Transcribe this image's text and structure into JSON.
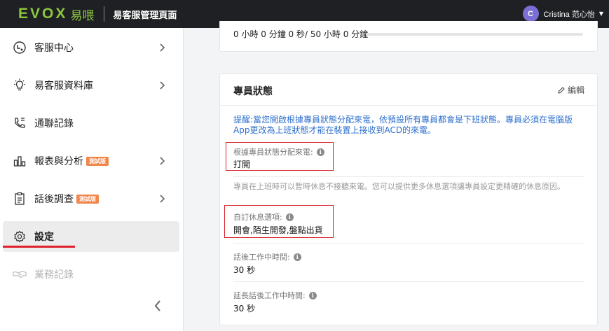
{
  "header": {
    "logo_mark": "EVOX",
    "logo_sub": "易喂",
    "title": "易客服管理頁面",
    "user": {
      "initial": "C",
      "name": "Cristina 范心怡"
    }
  },
  "sidebar": {
    "items": [
      {
        "label": "客服中心",
        "icon": "headset-icon"
      },
      {
        "label": "易客服資料庫",
        "icon": "lightbulb-icon"
      },
      {
        "label": "通聯記錄",
        "icon": "phone-icon"
      },
      {
        "label": "報表與分析",
        "icon": "bar-chart-icon",
        "badge": "測試版"
      },
      {
        "label": "話後調查",
        "icon": "clipboard-icon",
        "badge": "測試版"
      },
      {
        "label": "設定",
        "icon": "gear-icon"
      },
      {
        "label": "業務記錄",
        "icon": "handshake-icon"
      }
    ]
  },
  "summary": {
    "progress_text": "0 小時 0 分鐘 0 秒/ 50 小時 0 分鐘"
  },
  "agent_status": {
    "title": "專員狀態",
    "edit_label": "編輯",
    "notice": "提醒:當您開啟根據專員狀態分配來電，依預設所有專員都會是下班狀態。專員必須在電腦版App更改為上班狀態才能在裝置上接收到ACD的來電。",
    "assign_label": "根據專員狀態分配來電:",
    "assign_value": "打開",
    "break_hint": "專員在上班時可以暫時休息不接聽來電。您可以提供更多休息選項讓專員設定更精確的休息原因。",
    "custom_break_label": "自訂休息選項:",
    "custom_break_value": "開會,陌生開發,盤點出貨",
    "after_call_label": "話後工作中時間:",
    "after_call_value": "30 秒",
    "extended_after_call_label": "延長話後工作中時間:",
    "extended_after_call_value": "30 秒"
  },
  "colors": {
    "brand_green": "#8cc63f",
    "header_bg": "#1f2023",
    "link_blue": "#2e6fce",
    "highlight_red": "#d8242b",
    "beta_orange": "#f0864b",
    "avatar_purple": "#7b6fd6"
  }
}
